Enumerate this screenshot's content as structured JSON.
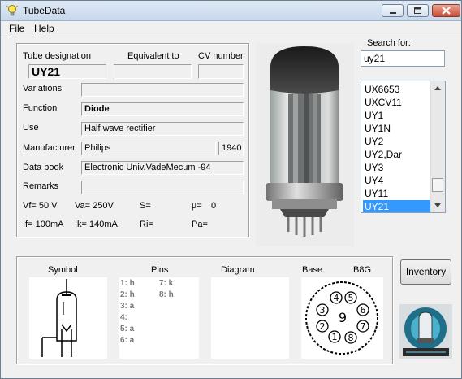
{
  "window": {
    "title": "TubeData"
  },
  "menu": {
    "file": "File",
    "help": "Help"
  },
  "details": {
    "tube_designation_label": "Tube designation",
    "tube_designation": "UY21",
    "equivalent_label": "Equivalent to",
    "equivalent": "",
    "cv_label": "CV number",
    "cv": "",
    "variations_label": "Variations",
    "variations": "",
    "function_label": "Function",
    "function": "Diode",
    "use_label": "Use",
    "use": "Half wave rectifier",
    "manufacturer_label": "Manufacturer",
    "manufacturer": "Philips",
    "year": "1940",
    "databook_label": "Data book",
    "databook": "Electronic Univ.VadeMecum -94",
    "remarks_label": "Remarks",
    "remarks": ""
  },
  "params": {
    "vf": "Vf= 50 V",
    "va": "Va= 250V",
    "s": "S=",
    "mu": "µ=",
    "mu_val": "0",
    "if": "If= 100mA",
    "ik": "Ik= 140mA",
    "ri": "Ri=",
    "pa": "Pa="
  },
  "search": {
    "label": "Search for:",
    "value": "uy21",
    "items": [
      "UX6653",
      "UXCV11",
      "UY1",
      "UY1N",
      "UY2",
      "UY2,Dar",
      "UY3",
      "UY4",
      "UY11",
      "UY21"
    ],
    "selected": "UY21"
  },
  "bottom": {
    "symbol_label": "Symbol",
    "pins_label": "Pins",
    "diagram_label": "Diagram",
    "base_label": "Base",
    "base_type": "B8G",
    "pins": [
      "1: h",
      "2: h",
      "3: a",
      "4:",
      "5: a",
      "6: a",
      "7: k",
      "8: h"
    ],
    "base_numbers": [
      "1",
      "2",
      "3",
      "4",
      "5",
      "6",
      "7",
      "8",
      "9"
    ]
  },
  "buttons": {
    "inventory": "Inventory"
  },
  "icons": {
    "app": "lightbulb-icon",
    "minimize": "minimize-icon",
    "maximize": "maximize-icon",
    "close": "close-icon"
  }
}
